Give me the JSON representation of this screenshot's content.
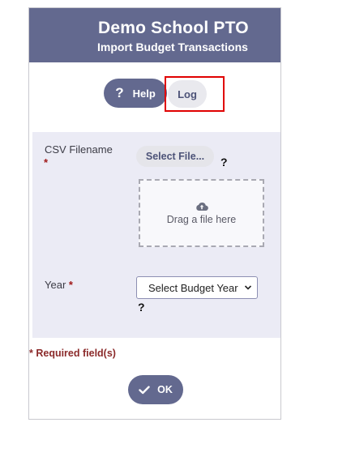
{
  "header": {
    "school_name": "Demo School PTO",
    "page_subtitle": "Import Budget Transactions"
  },
  "toolbar": {
    "help_label": "Help",
    "log_label": "Log"
  },
  "form": {
    "csv_label": "CSV Filename",
    "csv_required_marker": "*",
    "select_file_label": "Select File...",
    "drop_text": "Drag a file here",
    "year_label": "Year",
    "year_required_marker": "*",
    "year_select_value": "Select Budget Year",
    "help_marker": "?"
  },
  "footer": {
    "required_note": "* Required field(s)",
    "ok_label": "OK"
  },
  "icons": {
    "help": "question-mark-icon",
    "upload": "cloud-upload-icon",
    "ok": "checkmark-icon",
    "dropdown": "chevron-down-icon"
  },
  "colors": {
    "header_bg": "#63698f",
    "form_bg": "#ebebf5",
    "required": "#8b2a2a",
    "highlight": "#e00000"
  }
}
